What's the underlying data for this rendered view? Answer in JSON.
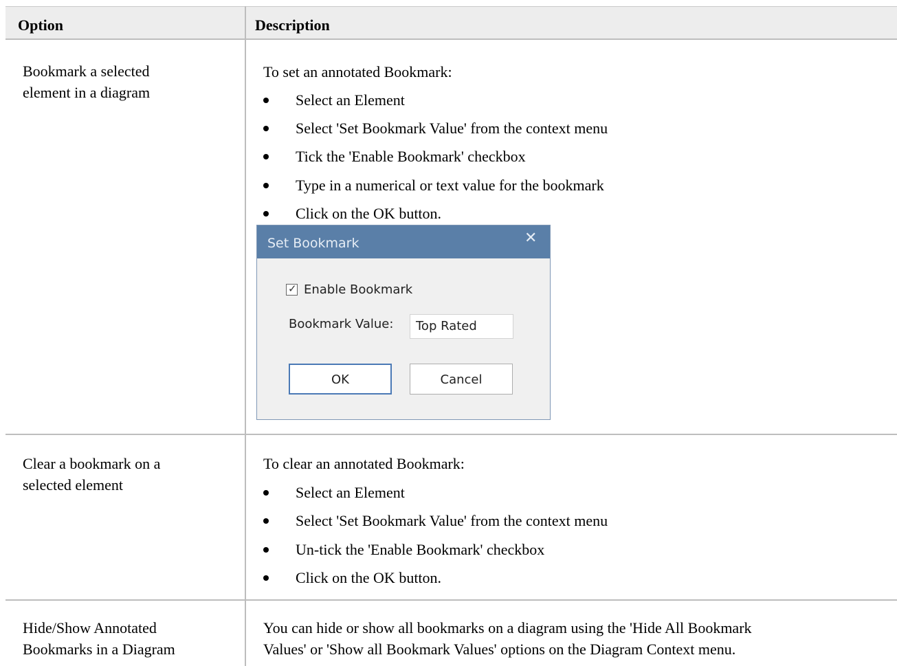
{
  "table": {
    "headers": {
      "option": "Option",
      "description": "Description"
    },
    "rows": [
      {
        "option_lines": [
          "Bookmark a selected",
          "element in a diagram"
        ],
        "intro": "To set an annotated Bookmark:",
        "bullets": [
          "Select an Element",
          "Select 'Set Bookmark Value' from the context menu",
          "Tick the 'Enable Bookmark' checkbox",
          "Type in a numerical or text value for the bookmark",
          "Click on the OK button."
        ]
      },
      {
        "option_lines": [
          "Clear a bookmark on a",
          "selected element"
        ],
        "intro": "To clear an annotated Bookmark:",
        "bullets": [
          "Select an Element",
          "Select 'Set Bookmark Value' from the context menu",
          "Un-tick the 'Enable Bookmark'  checkbox",
          "Click on the OK button."
        ]
      },
      {
        "option_lines": [
          "Hide/Show Annotated",
          "Bookmarks in a Diagram"
        ],
        "desc_lines": [
          "You can hide or show all bookmarks on a diagram using the 'Hide All Bookmark",
          "Values' or 'Show all Bookmark Values' options on the Diagram Context menu."
        ]
      }
    ]
  },
  "dialog": {
    "title": "Set Bookmark",
    "close_glyph": "✕",
    "enable_label": "Enable Bookmark",
    "enable_checked": true,
    "value_label": "Bookmark Value:",
    "value": "Top Rated",
    "ok_label": "OK",
    "cancel_label": "Cancel"
  }
}
